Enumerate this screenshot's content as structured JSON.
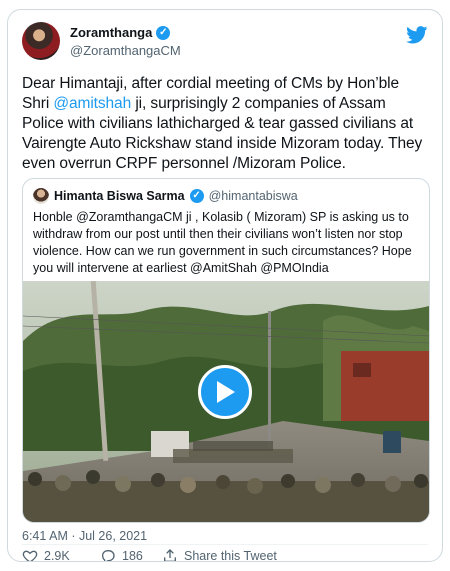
{
  "tweet": {
    "display_name": "Zoramthanga",
    "handle": "@ZoramthangaCM",
    "text_before": "Dear Himantaji, after cordial meeting of CMs by Hon’ble Shri ",
    "mention": "@amitshah",
    "text_after": " ji, surprisingly 2 companies of Assam Police with civilians lathicharged & tear gassed civilians at Vairengte Auto Rickshaw stand inside Mizoram today. They even overrun CRPF personnel /Mizoram Police.",
    "timestamp": "6:41 AM · Jul 26, 2021"
  },
  "quote": {
    "display_name": "Himanta Biswa Sarma",
    "handle": "@himantabiswa",
    "text": "Honble @ZoramthangaCM ji , Kolasib ( Mizoram) SP is asking us to withdraw from our post until then their civilians won’t listen nor stop violence. How can we run government in such circumstances? Hope you will intervene at earliest @AmitShah @PMOIndia"
  },
  "actions": {
    "likes": "2.9K",
    "replies": "186",
    "share_label": "Share this Tweet"
  },
  "icons": {
    "verified": "verified-badge-icon",
    "brand": "twitter-bird-icon",
    "play": "play-icon",
    "like": "heart-icon",
    "reply": "reply-icon",
    "share": "share-icon"
  },
  "colors": {
    "accent": "#1d9bf0",
    "text": "#0f1419",
    "muted": "#536471",
    "border": "#cfd9de"
  }
}
